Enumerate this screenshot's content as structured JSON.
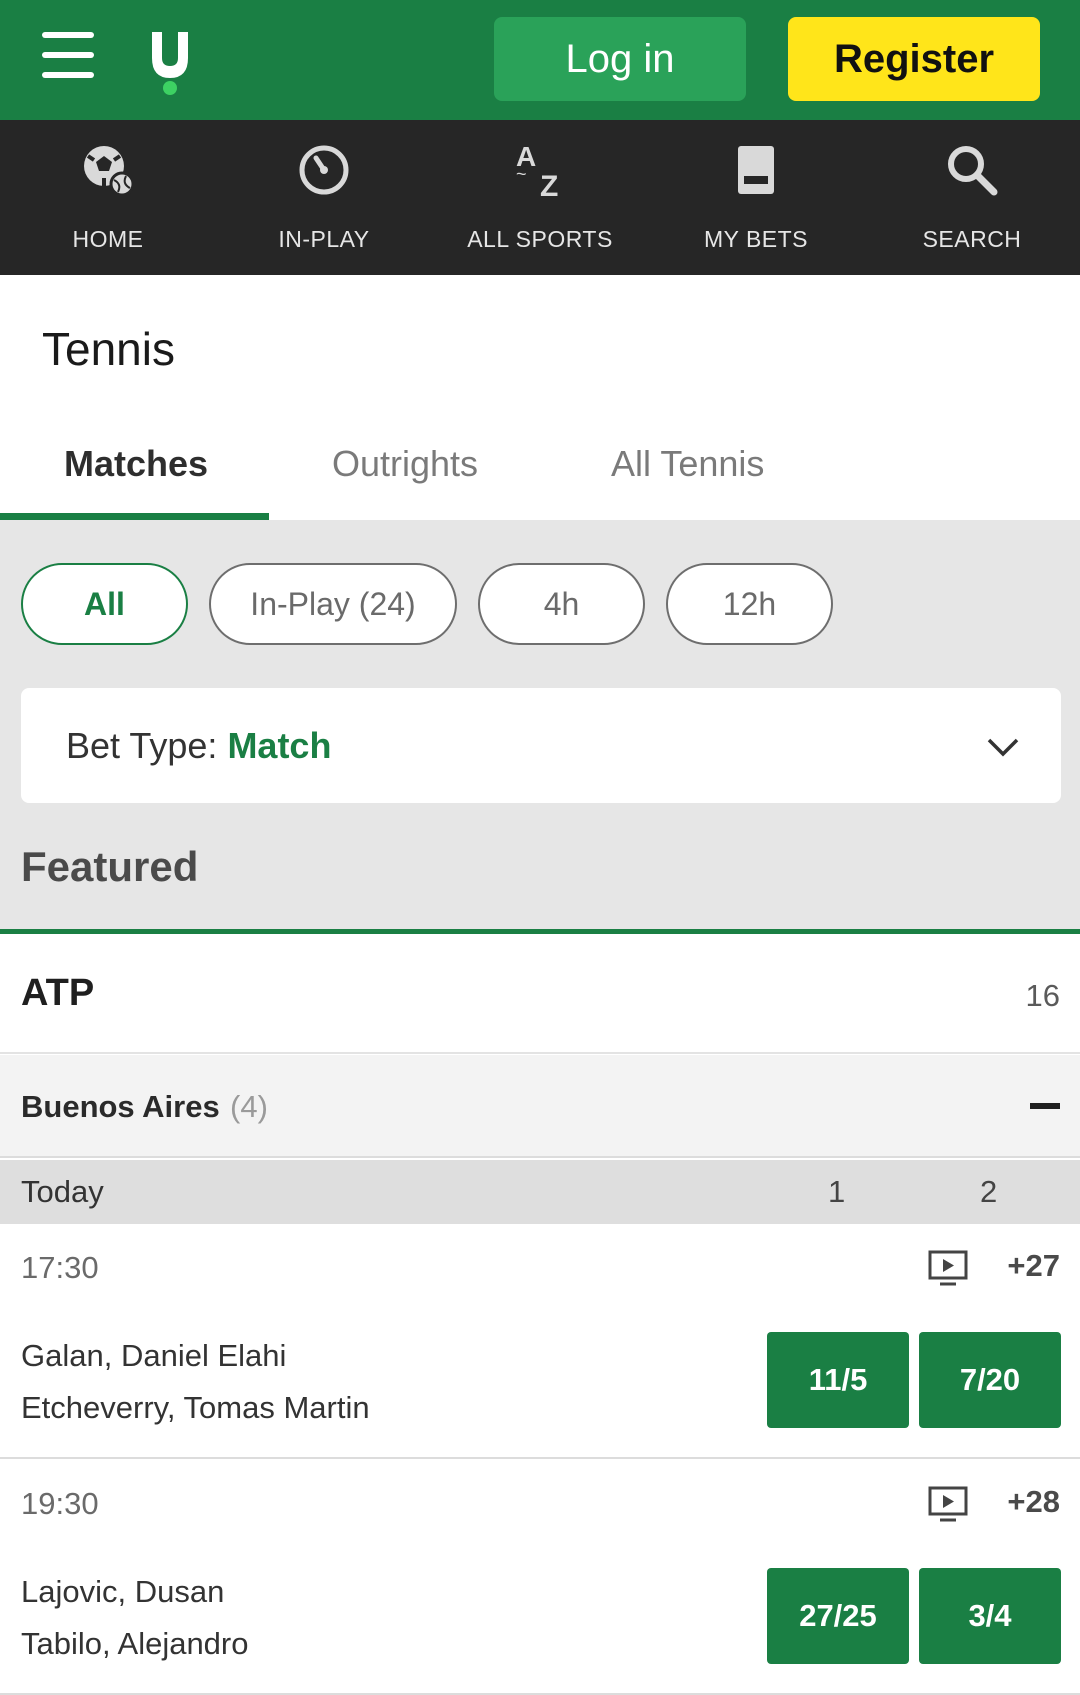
{
  "header": {
    "login_label": "Log in",
    "register_label": "Register",
    "brand_color": "#1a7f44",
    "register_color": "#ffe51a"
  },
  "nav": [
    {
      "label": "HOME",
      "icon": "football-tennis-ball-icon"
    },
    {
      "label": "IN-PLAY",
      "icon": "stopwatch-icon"
    },
    {
      "label": "ALL SPORTS",
      "icon": "a-to-z-icon"
    },
    {
      "label": "MY BETS",
      "icon": "betslip-icon"
    },
    {
      "label": "SEARCH",
      "icon": "search-icon"
    }
  ],
  "page_title": "Tennis",
  "tabs": [
    {
      "label": "Matches",
      "active": true
    },
    {
      "label": "Outrights",
      "active": false
    },
    {
      "label": "All Tennis",
      "active": false
    }
  ],
  "filters": [
    {
      "label": "All",
      "active": true
    },
    {
      "label": "In-Play (24)",
      "active": false
    },
    {
      "label": "4h",
      "active": false
    },
    {
      "label": "12h",
      "active": false
    }
  ],
  "bet_type": {
    "label": "Bet Type:",
    "value": "Match"
  },
  "featured_label": "Featured",
  "league": {
    "name": "ATP",
    "count": "16"
  },
  "competition": {
    "name": "Buenos Aires",
    "count": "(4)"
  },
  "date_header": {
    "label": "Today",
    "col1": "1",
    "col2": "2"
  },
  "matches": [
    {
      "time": "17:30",
      "more": "+27",
      "player1": "Galan, Daniel Elahi",
      "player2": "Etcheverry, Tomas Martin",
      "odd1": "11/5",
      "odd2": "7/20"
    },
    {
      "time": "19:30",
      "more": "+28",
      "player1": "Lajovic, Dusan",
      "player2": "Tabilo, Alejandro",
      "odd1": "27/25",
      "odd2": "3/4"
    }
  ]
}
